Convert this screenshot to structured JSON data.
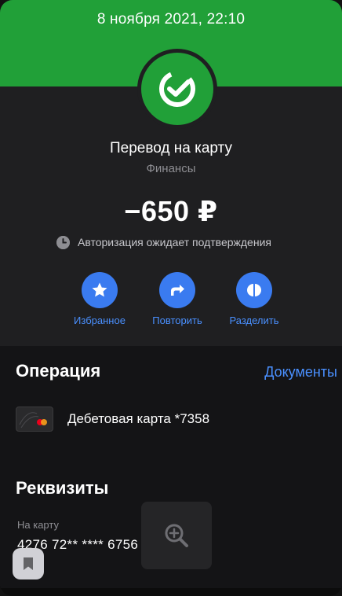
{
  "header": {
    "datetime": "8 ноября 2021, 22:10",
    "brand_color": "#21a038"
  },
  "operation_summary": {
    "title": "Перевод на карту",
    "category": "Финансы",
    "amount": "−650 ₽",
    "status": "Авторизация ожидает подтверждения",
    "status_icon": "clock-icon",
    "logo_icon": "sber-check-icon"
  },
  "actions": [
    {
      "label": "Избранное",
      "icon": "star-icon"
    },
    {
      "label": "Повторить",
      "icon": "repeat-share-icon"
    },
    {
      "label": "Разделить",
      "icon": "split-icon"
    }
  ],
  "operation": {
    "title": "Операция",
    "docs_link": "Документы",
    "card_label": "Дебетовая карта *7358",
    "card_icon": "bank-card-icon"
  },
  "requisites": {
    "title": "Реквизиты",
    "to_card_label": "На карту",
    "to_card_value": "4276 72** **** 6756",
    "zoom_icon": "zoom-in-icon"
  },
  "floating": {
    "bookmark_icon": "bookmark-icon"
  },
  "colors": {
    "accent": "#3a7bf0",
    "link": "#4a90ff",
    "background": "#1c1c1e"
  }
}
